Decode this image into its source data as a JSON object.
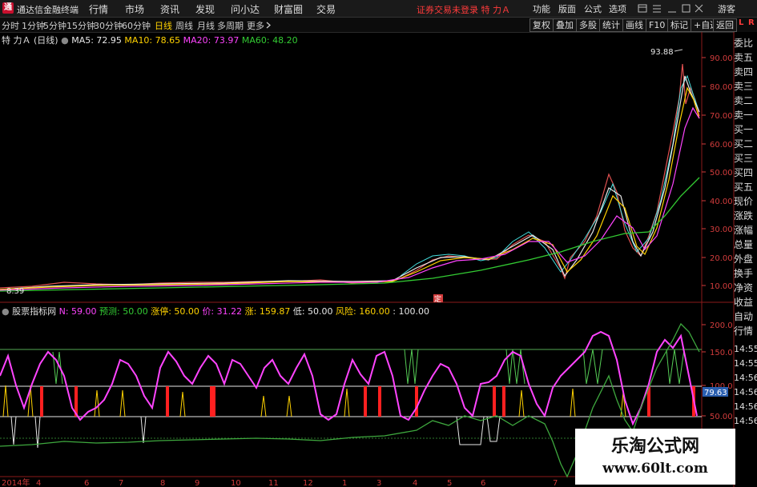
{
  "titlebar": {
    "logo": "通",
    "app_name": "通达信金融终端",
    "menus": [
      "行情",
      "市场",
      "资讯",
      "发现",
      "问小达",
      "财富圈",
      "交易"
    ],
    "warning": "证券交易未登录  特 力Ａ",
    "right_menus": [
      "功能",
      "版面",
      "公式",
      "选项"
    ],
    "guest": "游客",
    "colors": {
      "warning": "#ff3b3b",
      "logo": "#c8102e"
    }
  },
  "toolbar": {
    "timeframes": [
      "分时",
      "1分钟",
      "5分钟",
      "15分钟",
      "30分钟",
      "60分钟",
      "日线",
      "周线",
      "月线",
      "多周期",
      "更多"
    ],
    "active": "日线",
    "more_icon": "chevron-right-icon",
    "right_buttons": [
      "复权",
      "叠加",
      "多股",
      "统计",
      "画线",
      "F10",
      "标记",
      "+自选",
      "返回"
    ]
  },
  "main_chart": {
    "stock": "特 力Ａ",
    "period": "(日线)",
    "ma": [
      {
        "label": "MA5: 72.95",
        "color": "#e8e8e8"
      },
      {
        "label": "MA10: 78.65",
        "color": "#ffd200"
      },
      {
        "label": "MA20: 73.97",
        "color": "#ff44ff"
      },
      {
        "label": "MA60: 48.20",
        "color": "#33cc33"
      }
    ],
    "price_axis": [
      "90.00",
      "80.00",
      "70.00",
      "60.00",
      "50.00",
      "40.00",
      "30.00",
      "20.00",
      "10.00"
    ],
    "high_label": "93.88",
    "low_label": "8.39",
    "marker": "定",
    "corner_labels": [
      "L",
      "R"
    ]
  },
  "indicator": {
    "name": "股票指标网",
    "items": [
      {
        "label": "N: 59.00",
        "color": "#ff44ff"
      },
      {
        "label": "预测: 50.00",
        "color": "#33cc33"
      },
      {
        "label": "涨停: 50.00",
        "color": "#ffd200"
      },
      {
        "label": "价: 31.22",
        "color": "#ff44ff"
      },
      {
        "label": "涨: 159.87",
        "color": "#ffd200"
      },
      {
        "label": "低: 50.00",
        "color": "#e8e8e8"
      },
      {
        "label": "风险: 160.00",
        "color": "#ffd200"
      },
      {
        "label": ": 100.00",
        "color": "#e8e8e8"
      }
    ],
    "axis": [
      "200.0",
      "150.0",
      "100.0",
      "50.00"
    ],
    "current_value": "79.63"
  },
  "date_axis": [
    "2014年",
    "4",
    "6",
    "7",
    "8",
    "9",
    "10",
    "11",
    "12",
    "1",
    "3",
    "4",
    "5",
    "6",
    "7"
  ],
  "right_panel": {
    "quote_items": [
      "委比",
      "卖五",
      "卖四",
      "卖三",
      "卖二",
      "卖一",
      "买一",
      "买二",
      "买三",
      "买四",
      "买五",
      "现价",
      "涨跌",
      "涨幅",
      "总量",
      "外盘",
      "换手",
      "净资",
      "收益"
    ],
    "lower_items": [
      "自动",
      "行情"
    ],
    "times": [
      "14:55",
      "14:55",
      "14:56",
      "14:56",
      "14:56",
      "14:56"
    ]
  },
  "watermark": {
    "title": "乐淘公式网",
    "url": "www.60lt.com"
  }
}
